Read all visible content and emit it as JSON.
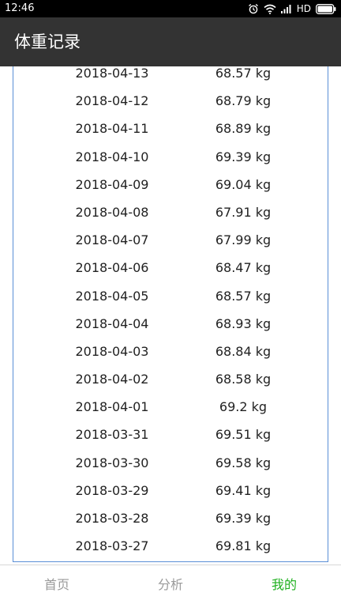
{
  "status_bar": {
    "time": "12:46",
    "network_label": "HD",
    "icons": [
      "alarm-icon",
      "wifi-icon",
      "signal-icon",
      "battery-icon"
    ]
  },
  "app_bar": {
    "title": "体重记录"
  },
  "records": [
    {
      "date": "2018-04-13",
      "weight": "68.57 kg"
    },
    {
      "date": "2018-04-12",
      "weight": "68.79 kg"
    },
    {
      "date": "2018-04-11",
      "weight": "68.89 kg"
    },
    {
      "date": "2018-04-10",
      "weight": "69.39 kg"
    },
    {
      "date": "2018-04-09",
      "weight": "69.04 kg"
    },
    {
      "date": "2018-04-08",
      "weight": "67.91 kg"
    },
    {
      "date": "2018-04-07",
      "weight": "67.99 kg"
    },
    {
      "date": "2018-04-06",
      "weight": "68.47 kg"
    },
    {
      "date": "2018-04-05",
      "weight": "68.57 kg"
    },
    {
      "date": "2018-04-04",
      "weight": "68.93 kg"
    },
    {
      "date": "2018-04-03",
      "weight": "68.84 kg"
    },
    {
      "date": "2018-04-02",
      "weight": "68.58 kg"
    },
    {
      "date": "2018-04-01",
      "weight": "69.2 kg"
    },
    {
      "date": "2018-03-31",
      "weight": "69.51 kg"
    },
    {
      "date": "2018-03-30",
      "weight": "69.58 kg"
    },
    {
      "date": "2018-03-29",
      "weight": "69.41 kg"
    },
    {
      "date": "2018-03-28",
      "weight": "69.39 kg"
    },
    {
      "date": "2018-03-27",
      "weight": "69.81 kg"
    }
  ],
  "bottom_nav": {
    "items": [
      {
        "label": "首页"
      },
      {
        "label": "分析"
      },
      {
        "label": "我的"
      }
    ],
    "active_color": "#1fb01f",
    "inactive_color": "#9a9a9a"
  },
  "colors": {
    "app_bar": "#333333",
    "list_border": "#5a8fd6"
  }
}
